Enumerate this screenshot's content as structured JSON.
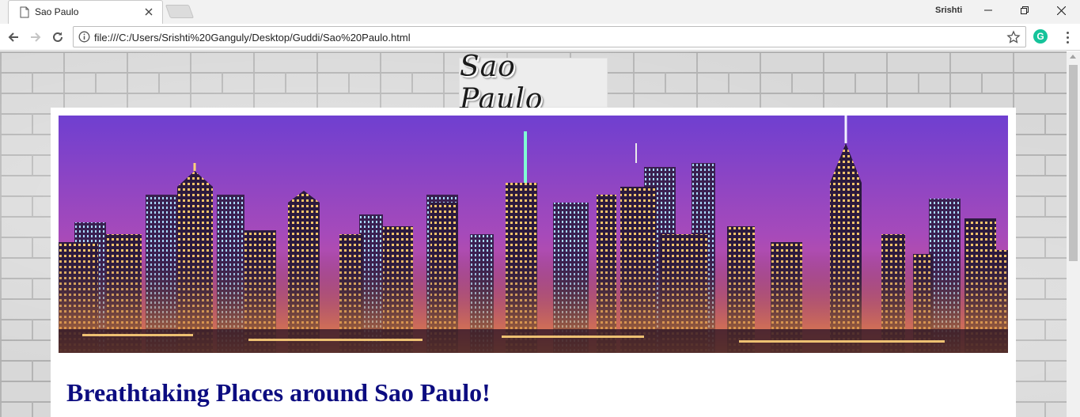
{
  "browser": {
    "tab_title": "Sao Paulo",
    "profile_name": "Srishti",
    "url": "file:///C:/Users/Srishti%20Ganguly/Desktop/Guddi/Sao%20Paulo.html",
    "extension_letter": "G"
  },
  "page": {
    "logo_text": "Sao Paulo",
    "heading": "Breathtaking Places around Sao Paulo!"
  },
  "colors": {
    "heading": "#0c0c80",
    "sky_top": "#7a3fd6",
    "sky_bottom": "#e0457a"
  }
}
